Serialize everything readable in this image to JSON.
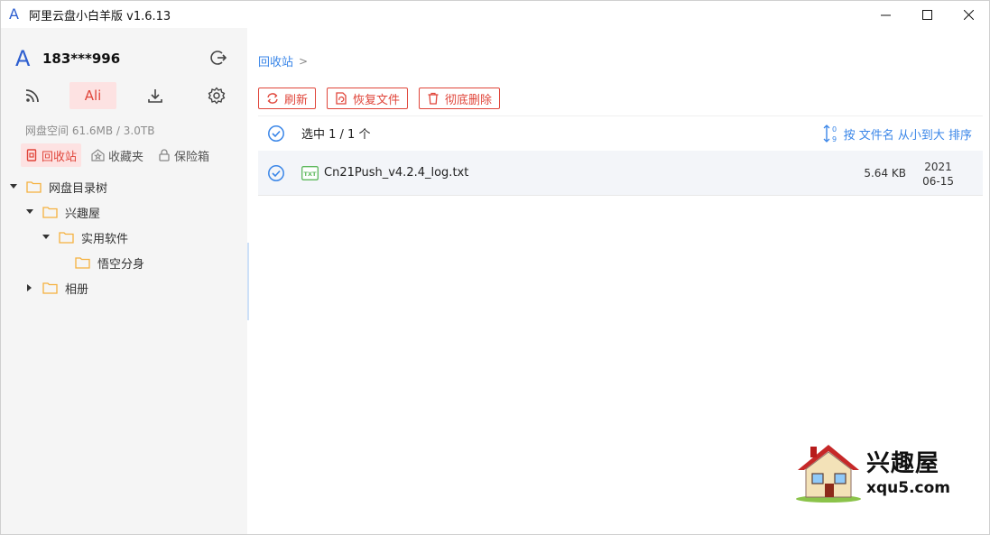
{
  "window": {
    "title": "阿里云盘小白羊版 v1.6.13",
    "logo_letter": "A"
  },
  "sidebar": {
    "user": {
      "logo_letter": "A",
      "name": "183***996"
    },
    "nav": {
      "ali_label": "Ali"
    },
    "quota": "网盘空间 61.6MB / 3.0TB",
    "tabs": [
      {
        "label": "回收站",
        "active": true
      },
      {
        "label": "收藏夹",
        "active": false
      },
      {
        "label": "保险箱",
        "active": false
      }
    ],
    "tree": {
      "root": "网盘目录树",
      "n1": "兴趣屋",
      "n2": "实用软件",
      "n3": "悟空分身",
      "n4": "相册"
    }
  },
  "main": {
    "breadcrumb": {
      "current": "回收站",
      "sep": ">"
    },
    "toolbar": {
      "refresh": "刷新",
      "restore": "恢复文件",
      "delete": "彻底删除"
    },
    "list_header": {
      "selected": "选中 1 / 1 个",
      "sort": "按 文件名 从小到大 排序"
    },
    "files": [
      {
        "type_badge": "TXT",
        "name": "Cn21Push_v4.2.4_log.txt",
        "size": "5.64 KB",
        "date_year": "2021",
        "date_md": "06-15"
      }
    ]
  },
  "watermark": {
    "text1": "兴趣屋",
    "text2": "xqu5.com"
  },
  "colors": {
    "accent_red": "#e0453a",
    "accent_blue": "#3a86e8",
    "folder": "#f5b13d"
  }
}
